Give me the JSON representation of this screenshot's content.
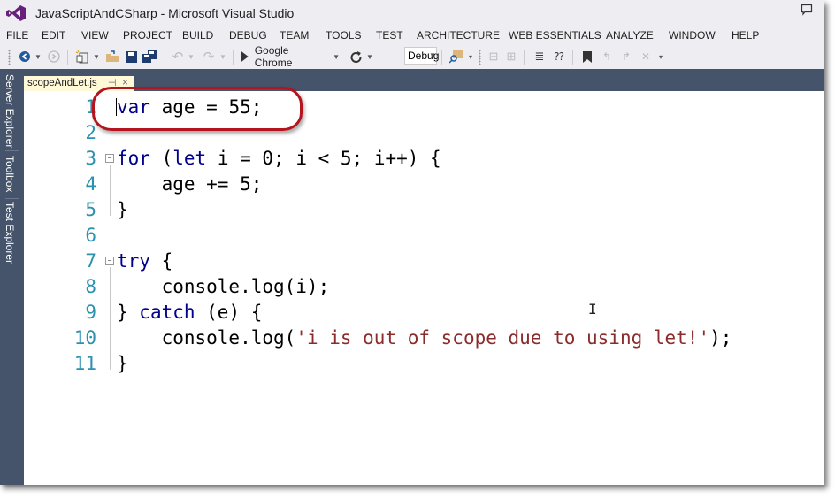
{
  "window": {
    "title": "JavaScriptAndCSharp - Microsoft Visual Studio",
    "icons": {
      "logo": "visual-studio-logo-icon",
      "feedback": "feedback-speech-bubble-icon"
    }
  },
  "menu": [
    "FILE",
    "EDIT",
    "VIEW",
    "PROJECT",
    "BUILD",
    "DEBUG",
    "TEAM",
    "TOOLS",
    "TEST",
    "ARCHITECTURE",
    "WEB ESSENTIALS",
    "ANALYZE",
    "WINDOW",
    "HELP"
  ],
  "toolbar": {
    "run_target": "Google Chrome",
    "configuration": "Debug",
    "icons": [
      "navigate-back-icon",
      "navigate-forward-icon",
      "new-project-icon",
      "open-file-icon",
      "save-icon",
      "save-all-icon",
      "undo-icon",
      "redo-icon",
      "start-icon",
      "refresh-icon",
      "find-in-files-icon",
      "comment-icon",
      "uncomment-icon",
      "indent-icon",
      "outdent-icon",
      "bookmark-icon",
      "prev-bookmark-icon",
      "next-bookmark-icon",
      "clear-bookmarks-icon"
    ]
  },
  "side_panels": [
    "Server Explorer",
    "Toolbox",
    "Test Explorer"
  ],
  "editor": {
    "file_tab": {
      "name": "scopeAndLet.js",
      "pin": "⊣",
      "close": "×"
    },
    "lines": [
      {
        "n": "1",
        "code": [
          {
            "t": "var",
            "c": "kw"
          },
          {
            "t": " age = 55;"
          }
        ]
      },
      {
        "n": "2",
        "code": []
      },
      {
        "n": "3",
        "code": [
          {
            "t": "for",
            "c": "kw"
          },
          {
            "t": " ("
          },
          {
            "t": "let",
            "c": "kw"
          },
          {
            "t": " i = 0; i < 5; i++) {"
          }
        ]
      },
      {
        "n": "4",
        "code": [
          {
            "t": "    age += 5;"
          }
        ]
      },
      {
        "n": "5",
        "code": [
          {
            "t": "}"
          }
        ]
      },
      {
        "n": "6",
        "code": []
      },
      {
        "n": "7",
        "code": [
          {
            "t": "try",
            "c": "kw"
          },
          {
            "t": " {"
          }
        ]
      },
      {
        "n": "8",
        "code": [
          {
            "t": "    console.log(i);"
          }
        ]
      },
      {
        "n": "9",
        "code": [
          {
            "t": "} "
          },
          {
            "t": "catch",
            "c": "kw"
          },
          {
            "t": " (e) {"
          }
        ]
      },
      {
        "n": "10",
        "code": [
          {
            "t": "    console.log("
          },
          {
            "t": "'i is out of scope due to using let!'",
            "c": "str"
          },
          {
            "t": ");"
          }
        ]
      },
      {
        "n": "11",
        "code": [
          {
            "t": "}"
          }
        ]
      }
    ],
    "highlight_color": "#b3141e",
    "keyword_color": "#00008b",
    "string_color": "#8b2c2c",
    "line_number_color": "#2b91af"
  }
}
